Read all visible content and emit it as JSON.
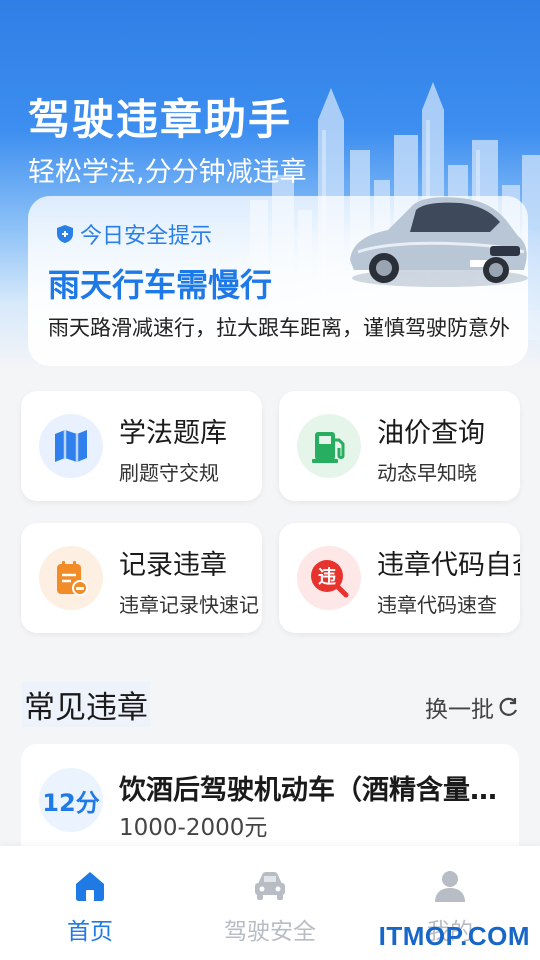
{
  "hero": {
    "title": "驾驶违章助手",
    "subtitle": "轻松学法,分分钟减违章",
    "tip_label": "今日安全提示",
    "tip_title": "雨天行车需慢行",
    "tip_body": "雨天路滑减速行，拉大跟车距离，谨慎驾驶防意外"
  },
  "features": [
    {
      "title": "学法题库",
      "subtitle": "刷题守交规",
      "icon": "map-icon",
      "color": "#2f80ed"
    },
    {
      "title": "油价查询",
      "subtitle": "动态早知晓",
      "icon": "fuel-icon",
      "color": "#27ae60"
    },
    {
      "title": "记录违章",
      "subtitle": "违章记录快速记",
      "icon": "notepad-icon",
      "color": "#f28c28"
    },
    {
      "title": "违章代码自查",
      "subtitle": "违章代码速查",
      "icon": "violation-icon",
      "glyph": "违",
      "color": "#e8322d"
    }
  ],
  "common": {
    "title": "常见违章",
    "refresh_label": "换一批",
    "items": [
      {
        "points": "12分",
        "title": "饮酒后驾驶机动车（酒精含量超标）",
        "fine": "1000-2000元"
      }
    ]
  },
  "nav": {
    "items": [
      {
        "label": "首页",
        "icon": "home-icon",
        "active": true
      },
      {
        "label": "驾驶安全",
        "icon": "car-icon",
        "active": false
      },
      {
        "label": "我的",
        "icon": "person-icon",
        "active": false
      }
    ]
  },
  "watermark": "ITMOP.COM",
  "colors": {
    "accent": "#1f7ae6",
    "inactive": "#b8bcc4"
  }
}
